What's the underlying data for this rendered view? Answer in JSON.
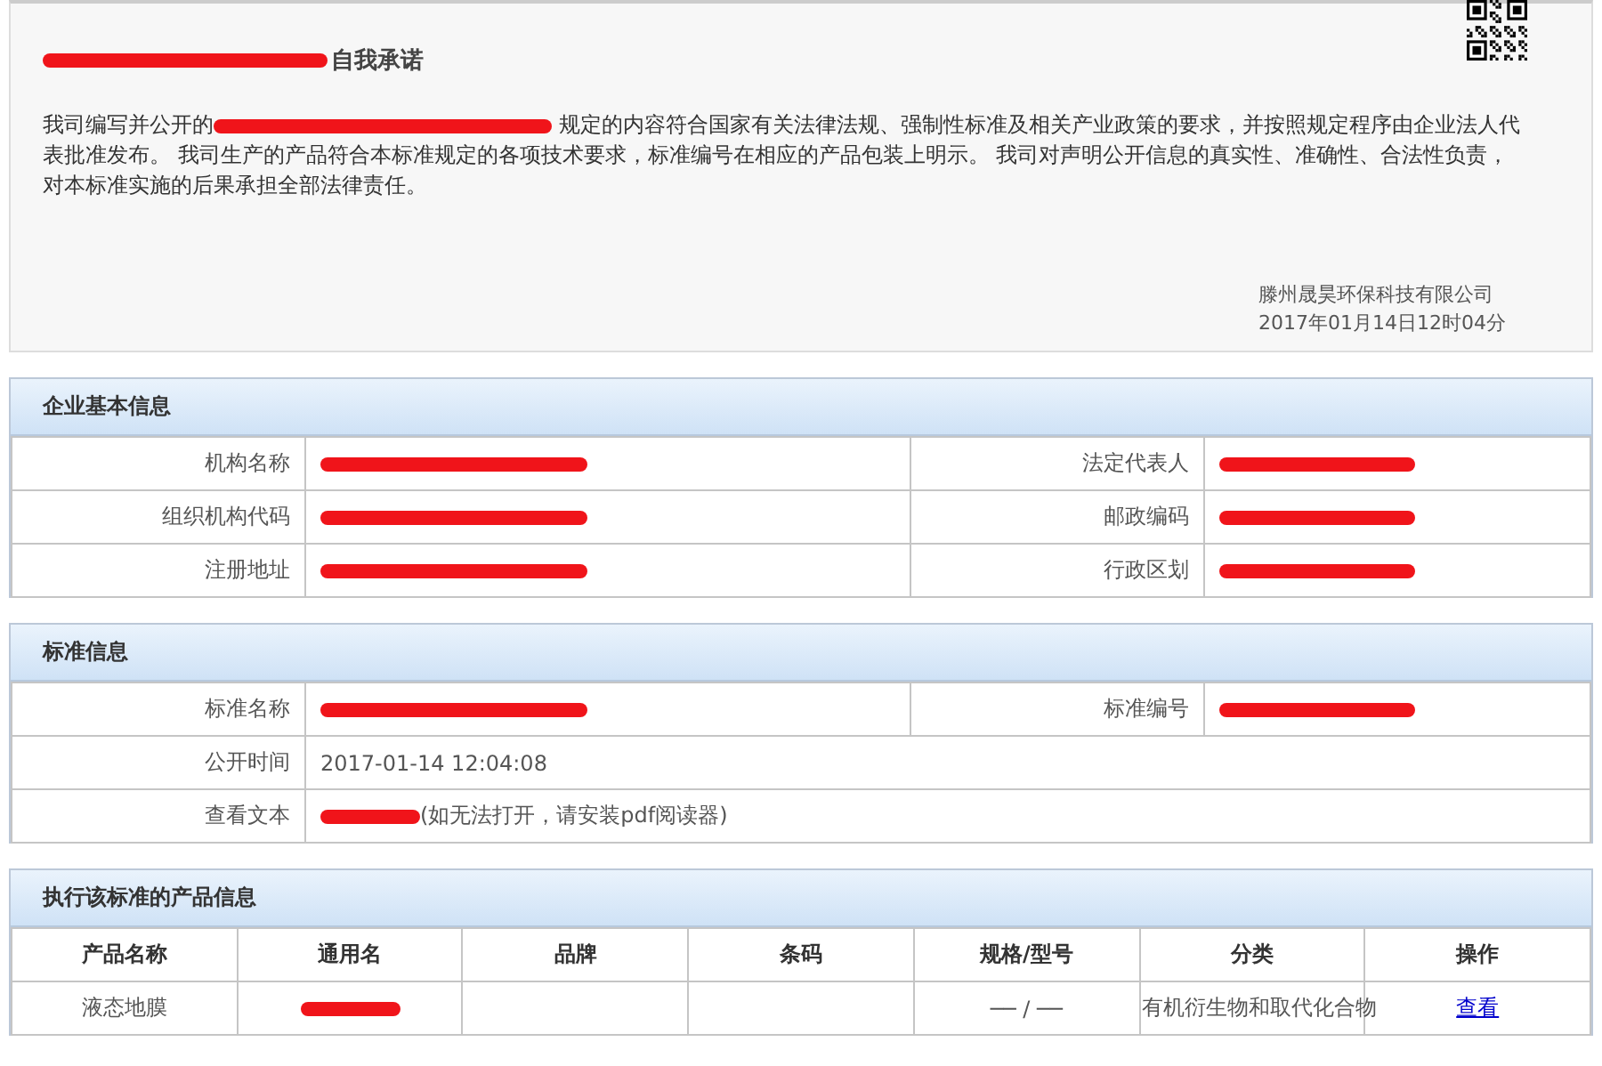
{
  "statement": {
    "title": {
      "redacted_prefix": true,
      "text": "自我承诺"
    },
    "paragraph": [
      {
        "kind": "text",
        "text": "我司编写并公开的"
      },
      {
        "kind": "redacted"
      },
      {
        "kind": "text",
        "text": " 规定的内容符合国家有关法律法规、强制性标准及相关产业政策的要求，并按照规定程序由企业法人代表批准发布。 我司生产的产品符合本标准规定的各项技术要求，标准编号在相应的产品包装上明示。 我司对声明公开信息的真实性、准确性、合法性负责，对本标准实施的后果承担全部法律责任。"
      }
    ],
    "company": "滕州晟昊环保科技有限公司",
    "date": "2017年01月14日12时04分"
  },
  "enterprise": {
    "heading": "企业基本信息",
    "rows": [
      [
        {
          "label": "机构名称",
          "kind": "redacted"
        },
        {
          "label": "法定代表人",
          "kind": "redacted"
        }
      ],
      [
        {
          "label": "组织机构代码",
          "kind": "redacted"
        },
        {
          "label": "邮政编码",
          "kind": "redacted"
        }
      ],
      [
        {
          "label": "注册地址",
          "kind": "redacted"
        },
        {
          "label": "行政区划",
          "kind": "redacted"
        }
      ]
    ]
  },
  "standard": {
    "heading": "标准信息",
    "rows": [
      [
        {
          "label": "标准名称",
          "kind": "redacted"
        },
        {
          "label": "标准编号",
          "kind": "redacted"
        }
      ],
      [
        {
          "label": "公开时间",
          "kind": "text",
          "text": "2017-01-14 12:04:08"
        }
      ],
      [
        {
          "label": "查看文本",
          "kind": "link",
          "note": "(如无法打开，请安装pdf阅读器)"
        }
      ]
    ]
  },
  "products": {
    "heading": "执行该标准的产品信息",
    "columns": [
      "产品名称",
      "通用名",
      "品牌",
      "条码",
      "规格/型号",
      "分类",
      "操作"
    ],
    "rows": [
      [
        {
          "kind": "text",
          "text": "液态地膜"
        },
        {
          "kind": "redacted"
        },
        {
          "kind": "empty"
        },
        {
          "kind": "empty"
        },
        {
          "kind": "text",
          "text": "── / ──"
        },
        {
          "kind": "text",
          "text": "有机衍生物和取代化合物"
        },
        {
          "kind": "link",
          "text": "查看"
        }
      ]
    ]
  }
}
